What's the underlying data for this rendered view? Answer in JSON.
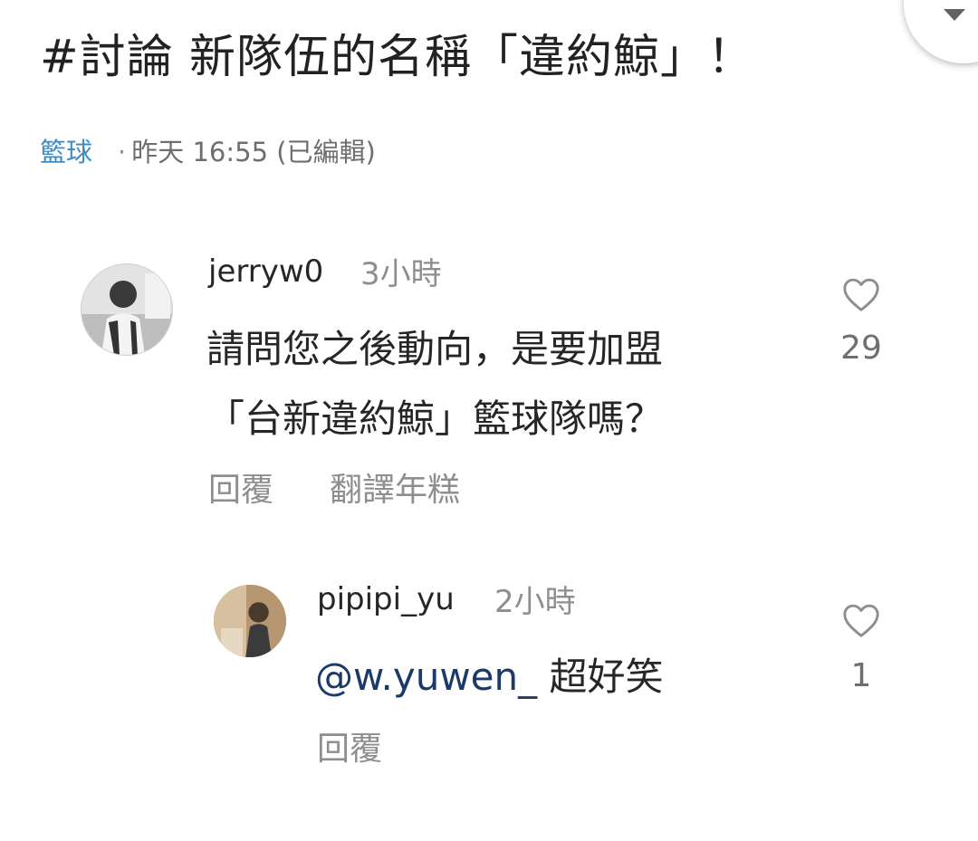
{
  "post": {
    "title": "#討論 新隊伍的名稱「違約鯨」！",
    "board": "籃球",
    "meta_dot": "·",
    "meta": "昨天 16:55 (已編輯)"
  },
  "comments": [
    {
      "username": "jerryw0",
      "time": "3小時",
      "text_line1": "請問您之後動向，是要加盟",
      "text_line2": "「台新違約鯨」籃球隊嗎？",
      "reply_label": "回覆",
      "translate_label": "翻譯年糕",
      "likes": "29",
      "like_icon": "heart-icon"
    },
    {
      "username": "pipipi_yu",
      "time": "2小時",
      "mention": "@w.yuwen_",
      "text": " 超好笑",
      "reply_label": "回覆",
      "likes": "1",
      "like_icon": "heart-icon"
    }
  ]
}
